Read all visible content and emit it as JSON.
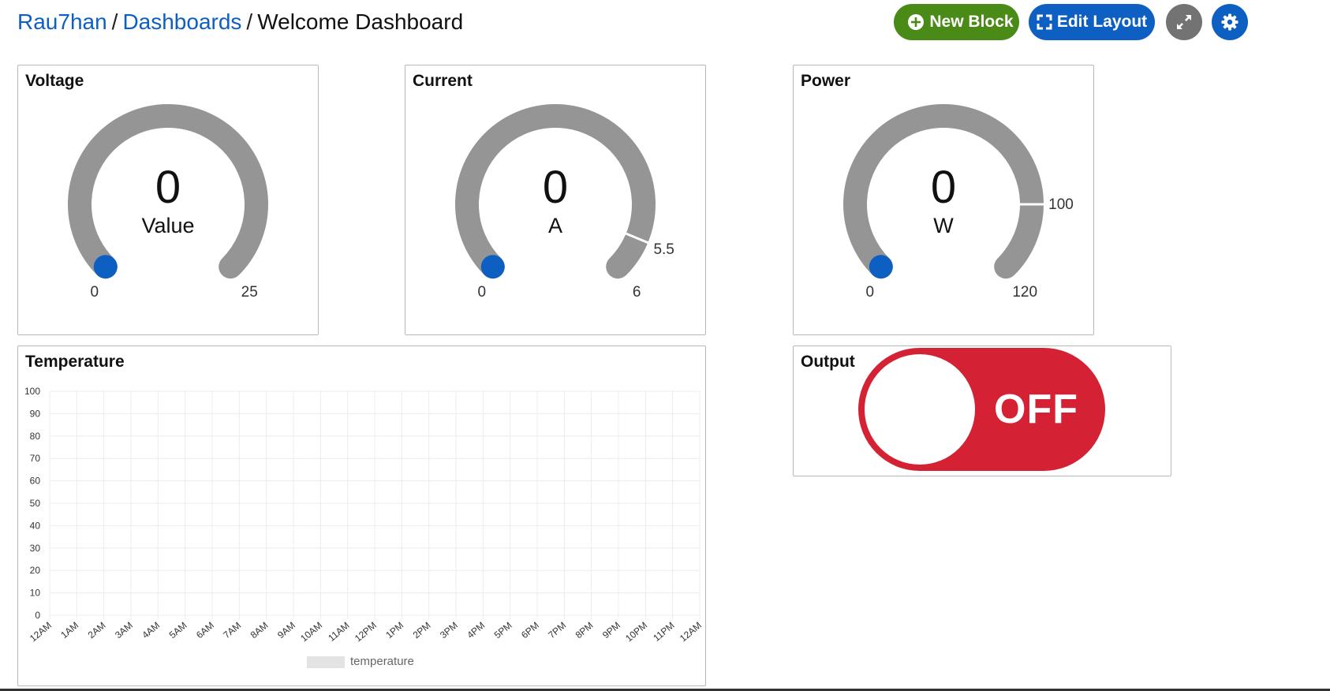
{
  "breadcrumb": {
    "user": "Rau7han",
    "section": "Dashboards",
    "separator": "/",
    "current": "Welcome Dashboard"
  },
  "toolbar": {
    "new_block_label": "New Block",
    "edit_layout_label": "Edit Layout",
    "fullscreen_icon": "expand-arrows-icon",
    "settings_icon": "gear-icon",
    "colors": {
      "new_block": "#4a8a17",
      "edit_layout": "#0d5fc2",
      "fullscreen": "#737373",
      "settings": "#0d5fc2"
    }
  },
  "gauges": {
    "voltage": {
      "title": "Voltage",
      "value": "0",
      "unit": "Value",
      "min": "0",
      "max": "25",
      "threshold": null
    },
    "current": {
      "title": "Current",
      "value": "0",
      "unit": "A",
      "min": "0",
      "max": "6",
      "threshold": "5.5"
    },
    "power": {
      "title": "Power",
      "value": "0",
      "unit": "W",
      "min": "0",
      "max": "120",
      "threshold": "100"
    }
  },
  "gauge_colors": {
    "track": "#959595",
    "indicator": "#0d5fc2"
  },
  "temperature": {
    "title": "Temperature",
    "legend_label": "temperature"
  },
  "output": {
    "title": "Output",
    "state_label": "OFF",
    "on": false,
    "color": "#d42234"
  },
  "chart_data": {
    "type": "line",
    "title": "Temperature",
    "xlabel": "",
    "ylabel": "",
    "ylim": [
      0,
      100
    ],
    "y_ticks": [
      "0",
      "10",
      "20",
      "30",
      "40",
      "50",
      "60",
      "70",
      "80",
      "90",
      "100"
    ],
    "categories": [
      "12AM",
      "1AM",
      "2AM",
      "3AM",
      "4AM",
      "5AM",
      "6AM",
      "7AM",
      "8AM",
      "9AM",
      "10AM",
      "11AM",
      "12PM",
      "1PM",
      "2PM",
      "3PM",
      "4PM",
      "5PM",
      "6PM",
      "7PM",
      "8PM",
      "9PM",
      "10PM",
      "11PM",
      "12AM"
    ],
    "series": [
      {
        "name": "temperature",
        "values": []
      }
    ],
    "grid": true,
    "legend": "bottom"
  }
}
